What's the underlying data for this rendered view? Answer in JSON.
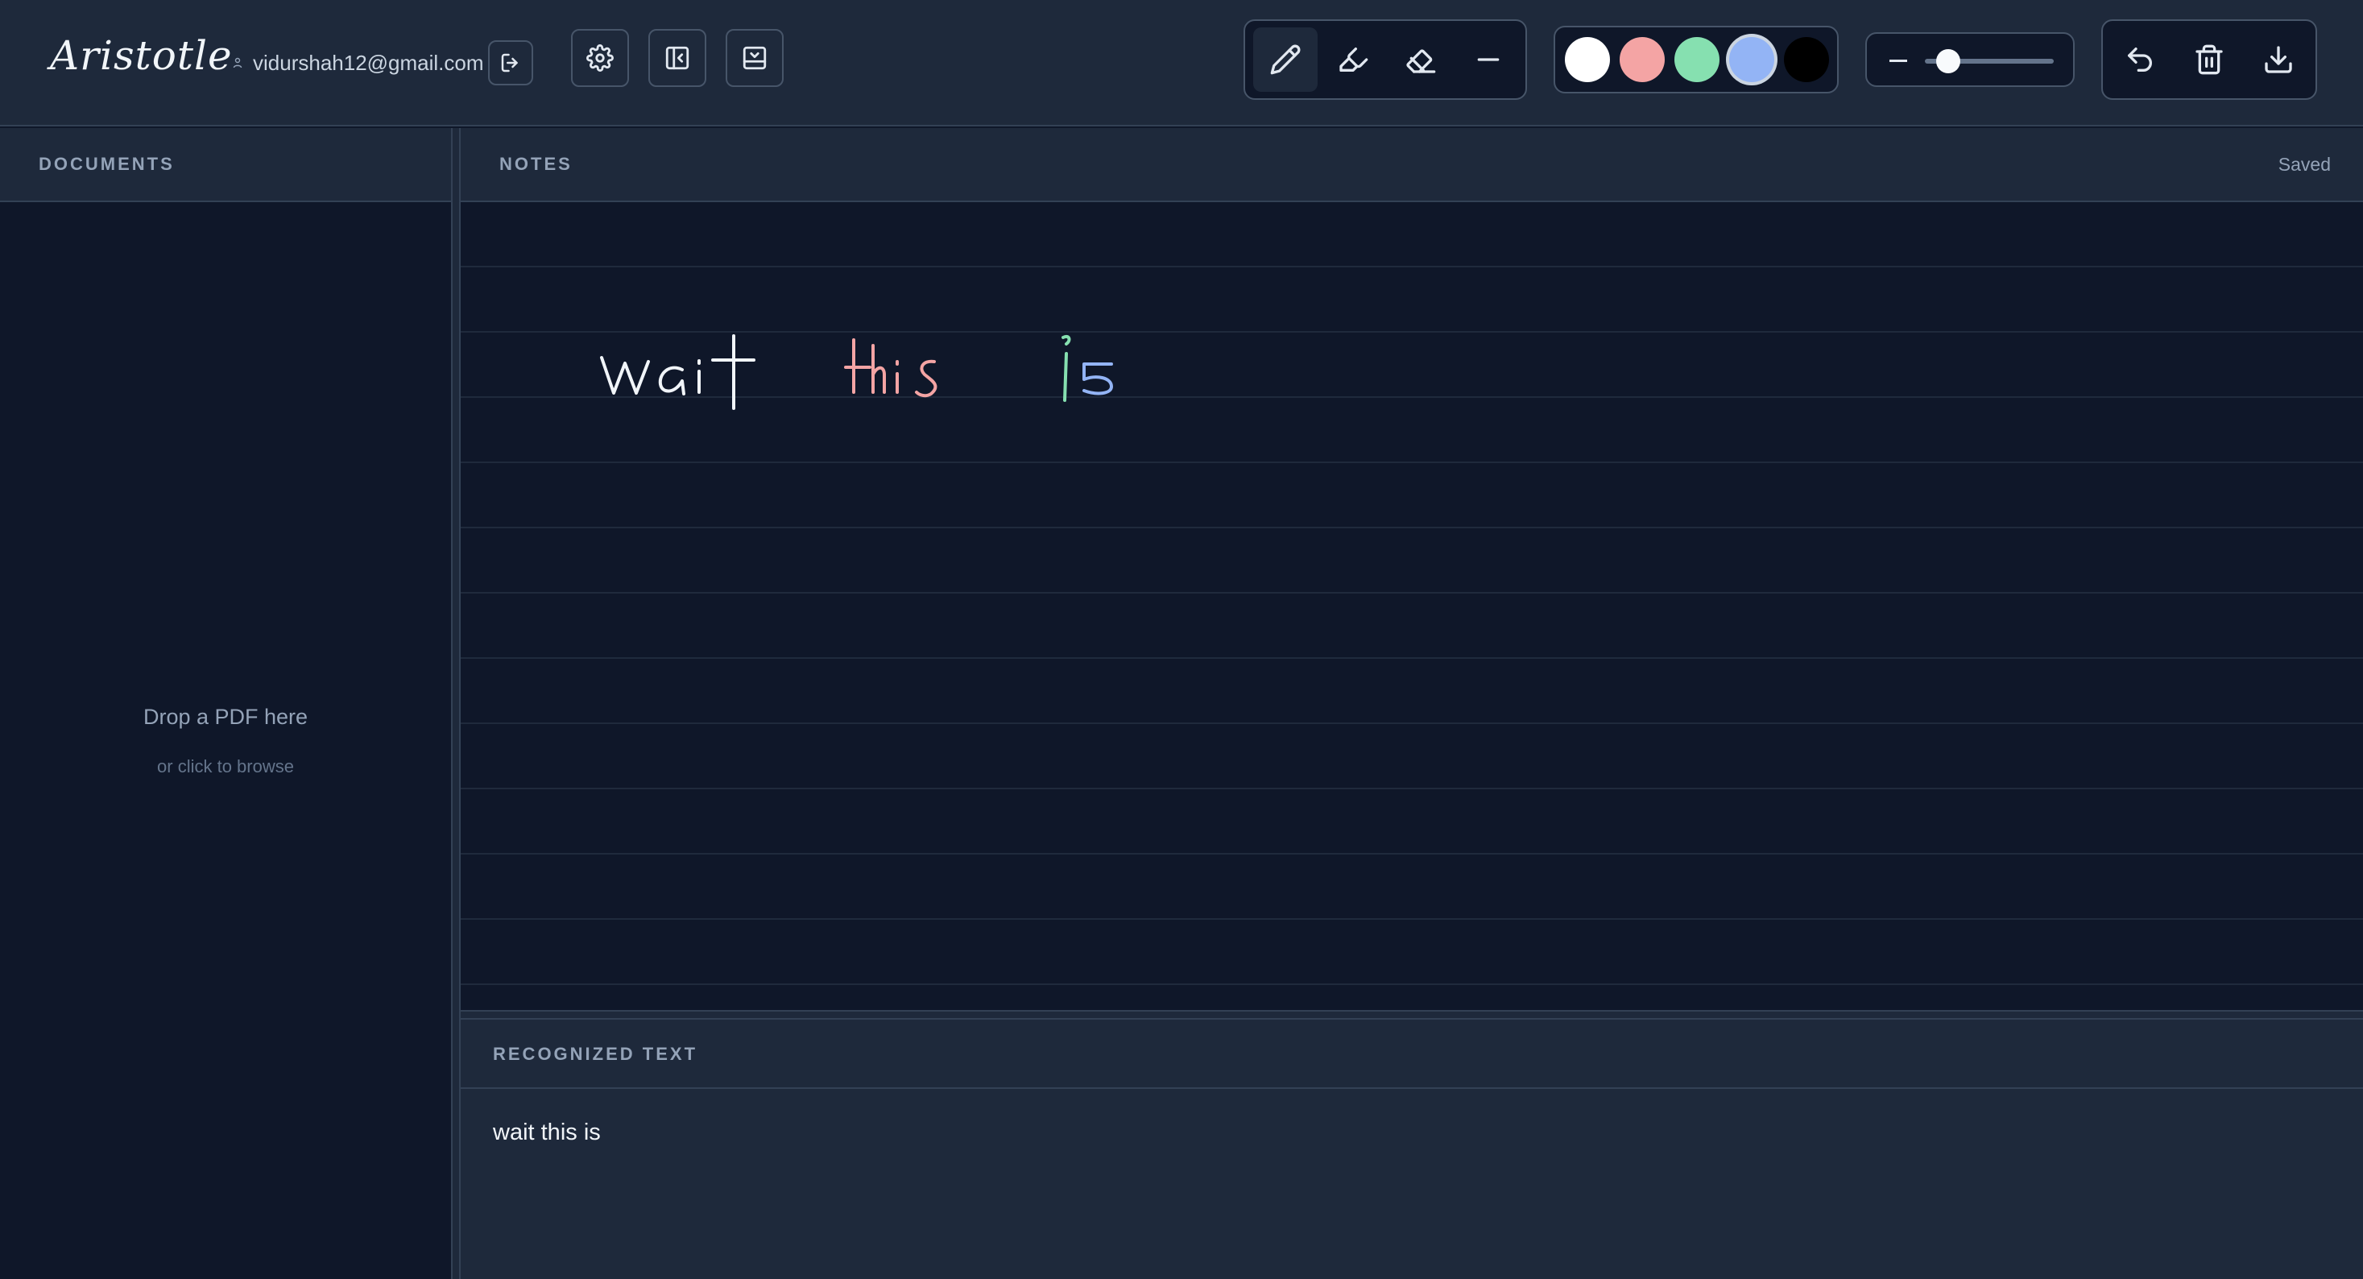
{
  "app": {
    "title": "Aristotle",
    "user_email": "vidurshah12@gmail.com"
  },
  "toolbar": {
    "buttons": [
      {
        "name": "logout-icon"
      },
      {
        "name": "settings-icon"
      },
      {
        "name": "toggle-sidebar-icon"
      },
      {
        "name": "toggle-recognized-panel-icon"
      }
    ],
    "tools": [
      {
        "name": "pen-icon",
        "active": true
      },
      {
        "name": "highlighter-icon",
        "active": false
      },
      {
        "name": "eraser-icon",
        "active": false
      },
      {
        "name": "line-icon",
        "active": false
      }
    ],
    "colors": [
      "#ffffff",
      "#f4a4a4",
      "#86e0b0",
      "#93b4f5",
      "#000000"
    ],
    "selected_color": "#93b4f5",
    "stroke_width_level": 0.18,
    "actions": [
      "undo-icon",
      "trash-icon",
      "download-icon"
    ]
  },
  "documents": {
    "title": "DOCUMENTS",
    "drop_main": "Drop a PDF here",
    "drop_sub": "or click to browse"
  },
  "notes": {
    "title": "NOTES",
    "status": "Saved",
    "ink": [
      {
        "word": "wait",
        "color": "#f1f5f9"
      },
      {
        "word": "this",
        "color": "#f4a4a4"
      },
      {
        "word": "is",
        "color": "#86e0b0",
        "second_color": "#93b4f5"
      }
    ]
  },
  "recognized": {
    "title": "RECOGNIZED TEXT",
    "text": "wait this is"
  }
}
